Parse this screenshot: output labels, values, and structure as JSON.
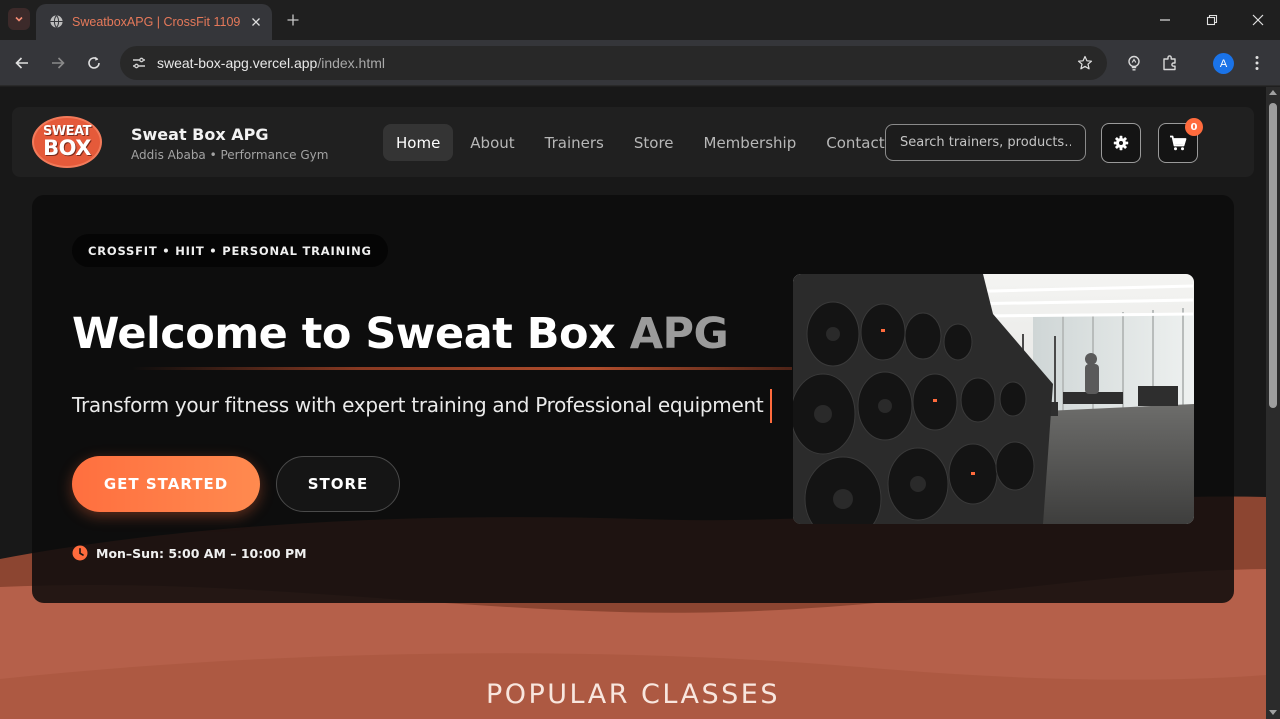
{
  "browser": {
    "tab_title": "SweatboxAPG | CrossFit 1109",
    "url_host": "sweat-box-apg.vercel.app",
    "url_path": "/index.html",
    "profile_initial": "A"
  },
  "header": {
    "brand_name": "Sweat Box APG",
    "brand_sub": "Addis Ababa • Performance Gym",
    "logo_top": "SWEAT",
    "logo_bottom": "BOX",
    "nav": [
      {
        "label": "Home",
        "active": true
      },
      {
        "label": "About",
        "active": false
      },
      {
        "label": "Trainers",
        "active": false
      },
      {
        "label": "Store",
        "active": false
      },
      {
        "label": "Membership",
        "active": false
      },
      {
        "label": "Contact",
        "active": false
      }
    ],
    "search_placeholder": "Search trainers, products…",
    "cart_count": "0"
  },
  "hero": {
    "pill": "CROSSFIT • HIIT • PERSONAL TRAINING",
    "title_main": "Welcome to Sweat Box ",
    "title_accent": "APG",
    "subtitle": "Transform your fitness with expert training and Professional equipment",
    "cta_primary": "GET STARTED",
    "cta_secondary": "STORE",
    "hours": "Mon–Sun: 5:00 AM – 10:00 PM"
  },
  "sections": {
    "popular_classes": "POPULAR CLASSES"
  },
  "colors": {
    "accent": "#ff6b3d",
    "wave_dark": "#8c4531",
    "wave_light": "#b5604a"
  }
}
